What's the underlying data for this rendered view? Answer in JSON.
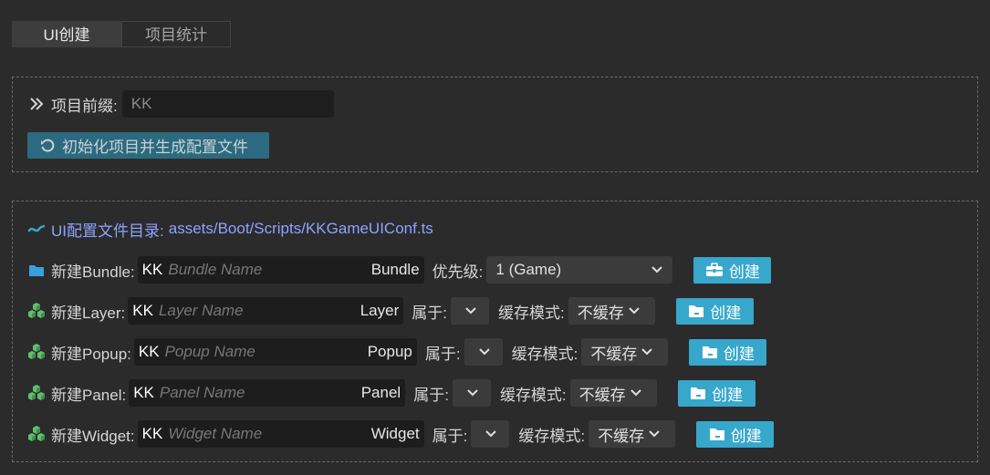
{
  "tabs": {
    "active": "UI创建",
    "inactive": "项目统计"
  },
  "init": {
    "prefix_label": "项目前缀:",
    "prefix_value": "KK",
    "init_button": "初始化项目并生成配置文件"
  },
  "config": {
    "label": "UI配置文件目录:",
    "path": "assets/Boot/Scripts/KKGameUIConf.ts"
  },
  "rows": {
    "bundle": {
      "label": "新建Bundle:",
      "prefix": "KK",
      "placeholder": "Bundle Name",
      "suffix": "Bundle",
      "priority_label": "优先级:",
      "priority_value": "1 (Game)",
      "create": "创建"
    },
    "layer": {
      "label": "新建Layer:",
      "prefix": "KK",
      "placeholder": "Layer Name",
      "suffix": "Layer",
      "belong_label": "属于:",
      "cache_label": "缓存模式:",
      "cache_value": "不缓存",
      "create": "创建"
    },
    "popup": {
      "label": "新建Popup:",
      "prefix": "KK",
      "placeholder": "Popup Name",
      "suffix": "Popup",
      "belong_label": "属于:",
      "cache_label": "缓存模式:",
      "cache_value": "不缓存",
      "create": "创建"
    },
    "panel": {
      "label": "新建Panel:",
      "prefix": "KK",
      "placeholder": "Panel Name",
      "suffix": "Panel",
      "belong_label": "属于:",
      "cache_label": "缓存模式:",
      "cache_value": "不缓存",
      "create": "创建"
    },
    "widget": {
      "label": "新建Widget:",
      "prefix": "KK",
      "placeholder": "Widget Name",
      "suffix": "Widget",
      "belong_label": "属于:",
      "cache_label": "缓存模式:",
      "cache_value": "不缓存",
      "create": "创建"
    }
  },
  "icons": {
    "double_chevron": "double-chevron-right-icon",
    "refresh": "refresh-icon",
    "wave": "wave-icon",
    "folder": "folder-icon",
    "cubes": "cubes-icon",
    "toolbox": "toolbox-icon",
    "folder_create": "folder-icon"
  },
  "colors": {
    "background": "#2b2b2b",
    "accent_button": "#37a7cc",
    "init_button": "#2c6a7f",
    "config_text": "#8fa2ff",
    "cubes_green": "#5cc26a",
    "folder_blue": "#3a9fe0"
  }
}
